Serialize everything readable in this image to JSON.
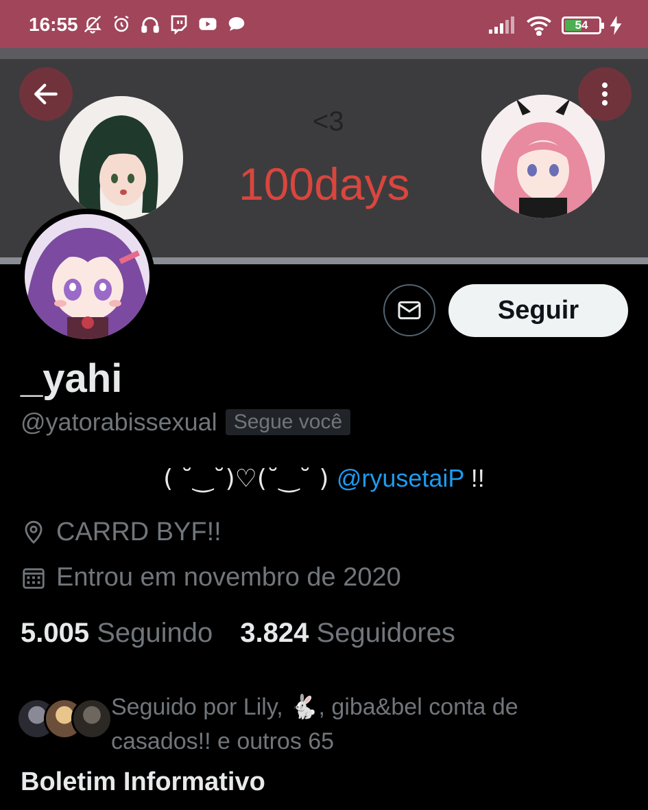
{
  "status_bar": {
    "time": "16:55",
    "battery": "54",
    "battery_level": 0.54,
    "icons": [
      "notifications-off-icon",
      "alarm-icon",
      "headphones-icon",
      "twitch-icon",
      "youtube-icon",
      "chat-icon",
      "signal-icon",
      "wifi-icon",
      "battery-icon",
      "charging-icon"
    ],
    "bg_color": "#a0455a"
  },
  "banner": {
    "heart_text": "<3",
    "days_text": "100days"
  },
  "profile": {
    "display_name": "_yahi",
    "handle": "@yatorabissexual",
    "follows_you": "Segue você",
    "follow_button": "Seguir",
    "bio_prefix": "( ˘‿˘)♡(˘‿˘ ) ",
    "bio_mention": "@ryusetaiP",
    "bio_suffix": " !!",
    "location": "CARRD BYF!!",
    "joined": "Entrou em novembro de 2020",
    "following_count": "5.005",
    "following_label": "Seguindo",
    "followers_count": "3.824",
    "followers_label": "Seguidores",
    "followed_by_text": "Seguido por Lily, 🐇, giba&bel conta de casados!! e outros 65"
  },
  "sections": {
    "newsletter_title": "Boletim Informativo"
  },
  "colors": {
    "accent": "#1d9bf0",
    "muted": "#71767b",
    "text": "#e7e9ea",
    "banner_text": "#d9463d"
  }
}
